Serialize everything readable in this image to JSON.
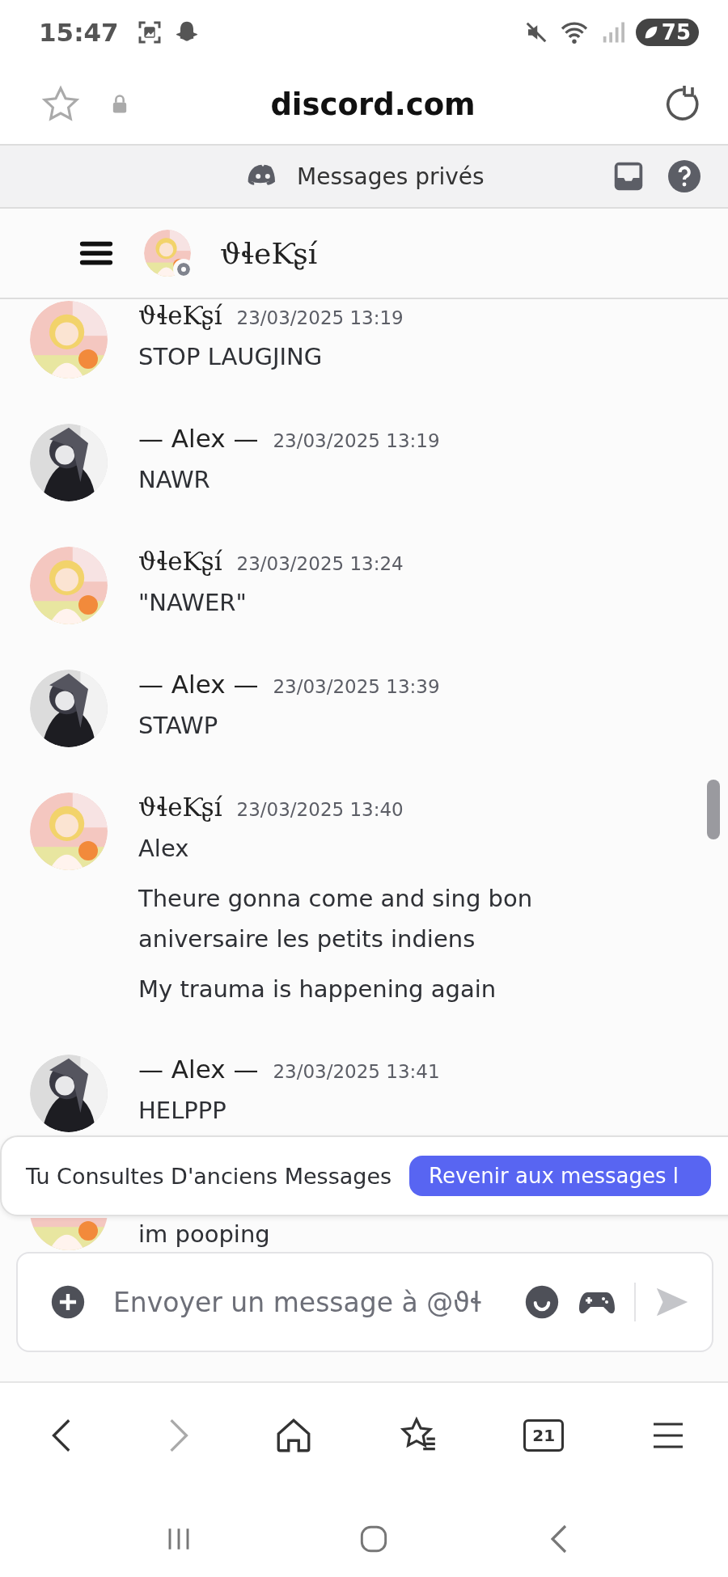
{
  "status_bar": {
    "time": "15:47",
    "battery": "75"
  },
  "browser": {
    "url": "discord.com"
  },
  "discord_header": {
    "title": "Messages privés"
  },
  "channel": {
    "name": "ϑɬeƘʂí"
  },
  "messages": [
    {
      "author": "ϑɬeƘʂí",
      "timestamp": "23/03/2025 13:19",
      "lines": [
        "STOP LAUGJING"
      ]
    },
    {
      "author": "— Alex —",
      "timestamp": "23/03/2025 13:19",
      "lines": [
        "NAWR"
      ]
    },
    {
      "author": "ϑɬeƘʂí",
      "timestamp": "23/03/2025 13:24",
      "lines": [
        "\"NAWER\""
      ]
    },
    {
      "author": "— Alex —",
      "timestamp": "23/03/2025 13:39",
      "lines": [
        "STAWP"
      ]
    },
    {
      "author": "ϑɬeƘʂí",
      "timestamp": "23/03/2025 13:40",
      "lines": [
        "Alex",
        "Theure gonna come and sing bon aniversaire les petits indiens",
        "My trauma is happening again"
      ]
    },
    {
      "author": "— Alex —",
      "timestamp": "23/03/2025 13:41",
      "lines": [
        "HELPPP"
      ]
    }
  ],
  "hidden_message": {
    "text": "im pooping"
  },
  "banner": {
    "text": "Tu Consultes D'anciens Messages",
    "button": "Revenir aux messages l"
  },
  "composer": {
    "placeholder": "Envoyer un message à @ϑɬ"
  },
  "browser_toolbar": {
    "forward_disabled": true,
    "tabs_count": "21"
  }
}
